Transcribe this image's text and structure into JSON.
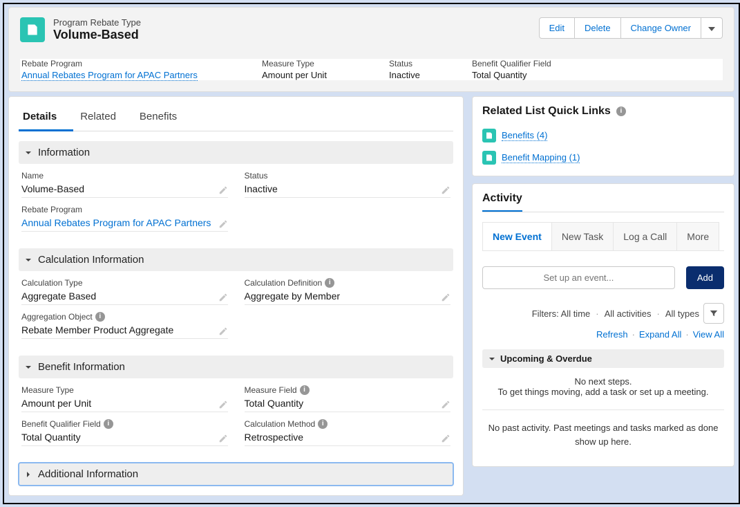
{
  "header": {
    "subtitle": "Program Rebate Type",
    "title": "Volume-Based",
    "actions": {
      "edit": "Edit",
      "delete": "Delete",
      "change_owner": "Change Owner"
    },
    "summary": {
      "rebate_program_label": "Rebate Program",
      "rebate_program_value": "Annual Rebates Program for APAC Partners",
      "measure_type_label": "Measure Type",
      "measure_type_value": "Amount per Unit",
      "status_label": "Status",
      "status_value": "Inactive",
      "benefit_qualifier_label": "Benefit Qualifier Field",
      "benefit_qualifier_value": "Total Quantity"
    }
  },
  "tabs": {
    "details": "Details",
    "related": "Related",
    "benefits": "Benefits"
  },
  "sections": {
    "information": {
      "title": "Information",
      "name_label": "Name",
      "name_value": "Volume-Based",
      "status_label": "Status",
      "status_value": "Inactive",
      "rebate_program_label": "Rebate Program",
      "rebate_program_value": "Annual Rebates Program for APAC Partners"
    },
    "calculation": {
      "title": "Calculation Information",
      "calc_type_label": "Calculation Type",
      "calc_type_value": "Aggregate Based",
      "calc_def_label": "Calculation Definition",
      "calc_def_value": "Aggregate by Member",
      "agg_obj_label": "Aggregation Object",
      "agg_obj_value": "Rebate Member Product Aggregate"
    },
    "benefit": {
      "title": "Benefit Information",
      "measure_type_label": "Measure Type",
      "measure_type_value": "Amount per Unit",
      "measure_field_label": "Measure Field",
      "measure_field_value": "Total Quantity",
      "benefit_qualifier_label": "Benefit Qualifier Field",
      "benefit_qualifier_value": "Total Quantity",
      "calc_method_label": "Calculation Method",
      "calc_method_value": "Retrospective"
    },
    "additional": {
      "title": "Additional Information"
    }
  },
  "related_quick_links": {
    "title": "Related List Quick Links",
    "items": [
      {
        "label": "Benefits (4)"
      },
      {
        "label": "Benefit Mapping (1)"
      }
    ]
  },
  "activity": {
    "title": "Activity",
    "subtabs": {
      "new_event": "New Event",
      "new_task": "New Task",
      "log_call": "Log a Call",
      "more": "More"
    },
    "placeholder": "Set up an event...",
    "add_label": "Add",
    "filter_label": "Filters: All time",
    "filter_activities": "All activities",
    "filter_types": "All types",
    "links": {
      "refresh": "Refresh",
      "expand": "Expand All",
      "view": "View All"
    },
    "upcoming_title": "Upcoming & Overdue",
    "no_next1": "No next steps.",
    "no_next2": "To get things moving, add a task or set up a meeting.",
    "no_activity": "No past activity. Past meetings and tasks marked as done show up here."
  }
}
